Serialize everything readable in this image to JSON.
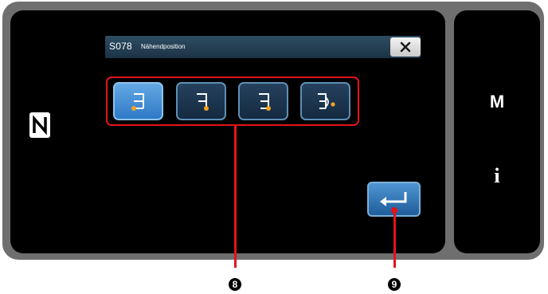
{
  "dialog": {
    "code": "S078",
    "title": "Nähendposition",
    "close_label": "×"
  },
  "end_positions": [
    {
      "icon": "stitch-end-position-1-icon",
      "selected": true
    },
    {
      "icon": "stitch-end-position-2-icon",
      "selected": false
    },
    {
      "icon": "stitch-end-position-3-icon",
      "selected": false
    },
    {
      "icon": "stitch-end-position-4-icon",
      "selected": false
    }
  ],
  "side_panel": {
    "mode_key": "M",
    "info_key": "i"
  },
  "callouts": {
    "positions_marker": "8",
    "enter_marker": "9"
  },
  "colors": {
    "accent_red": "#e2141b",
    "dot_orange": "#f4a422",
    "button_blue": "#2f78c5"
  }
}
